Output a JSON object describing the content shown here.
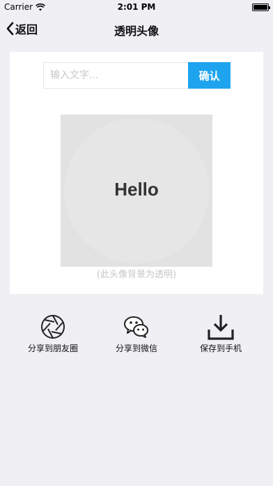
{
  "status_bar": {
    "carrier": "Carrier",
    "time": "2:01 PM"
  },
  "nav": {
    "back_label": "返回",
    "title": "透明头像"
  },
  "input": {
    "placeholder": "输入文字...",
    "value": ""
  },
  "confirm_label": "确认",
  "preview": {
    "text": "Hello",
    "hint": "(此头像背景为透明)"
  },
  "actions": [
    {
      "label": "分享到朋友圈",
      "icon": "camera-aperture-icon"
    },
    {
      "label": "分享到微信",
      "icon": "wechat-icon"
    },
    {
      "label": "保存到手机",
      "icon": "download-icon"
    }
  ],
  "colors": {
    "accent": "#1ea4ee",
    "background": "#efeff4",
    "preview_bg": "#e2e2e2"
  }
}
